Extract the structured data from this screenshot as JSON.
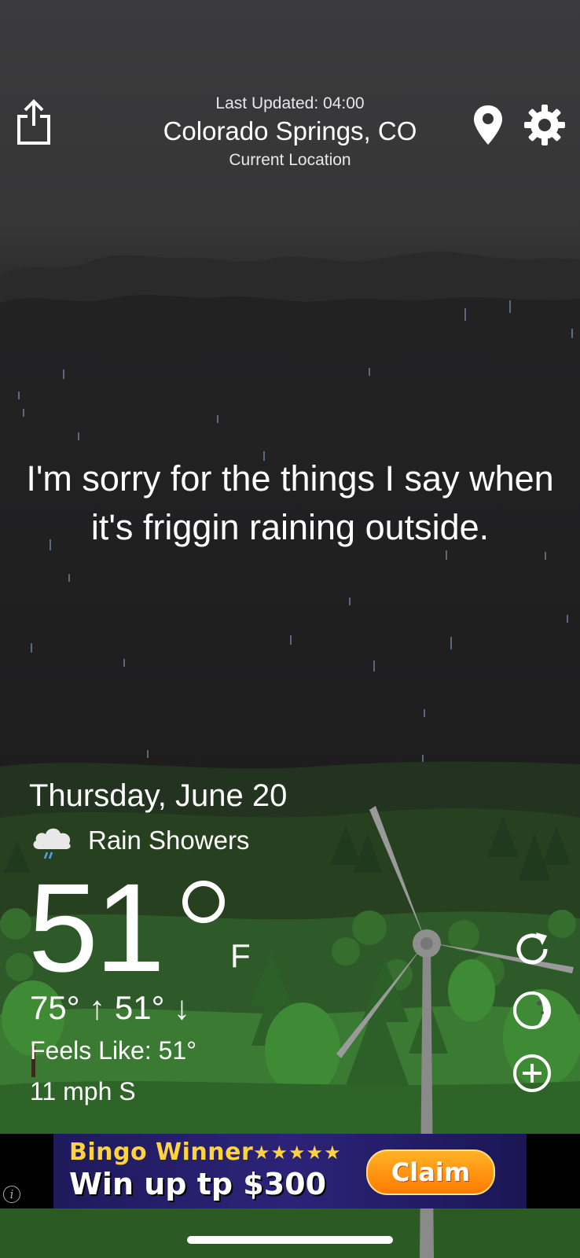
{
  "header": {
    "last_updated": "Last Updated: 04:00",
    "city": "Colorado Springs, CO",
    "location_label": "Current Location"
  },
  "quote": "I'm sorry for the things I say when it's friggin raining outside.",
  "weather": {
    "date": "Thursday, June 20",
    "condition": "Rain Showers",
    "condition_icon": "rain-cloud-icon",
    "temperature": "51",
    "unit": "F",
    "hi_lo": "75° ↑  51° ↓",
    "feels_like": "Feels Like: 51°",
    "wind": "11 mph S"
  },
  "side_actions": [
    {
      "name": "refresh-icon"
    },
    {
      "name": "moon-phase-icon"
    },
    {
      "name": "add-icon"
    }
  ],
  "ad": {
    "line1": "Bingo Winner",
    "stars": "★★★★★",
    "line2": "Win up tp $300",
    "cta": "Claim"
  },
  "colors": {
    "sky_top": "#3b3b3d",
    "sky_bottom": "#1d1d1e",
    "hill_green": "#2e5a2a",
    "ad_gold": "#ffd23f",
    "claim_orange": "#ff8c00"
  }
}
